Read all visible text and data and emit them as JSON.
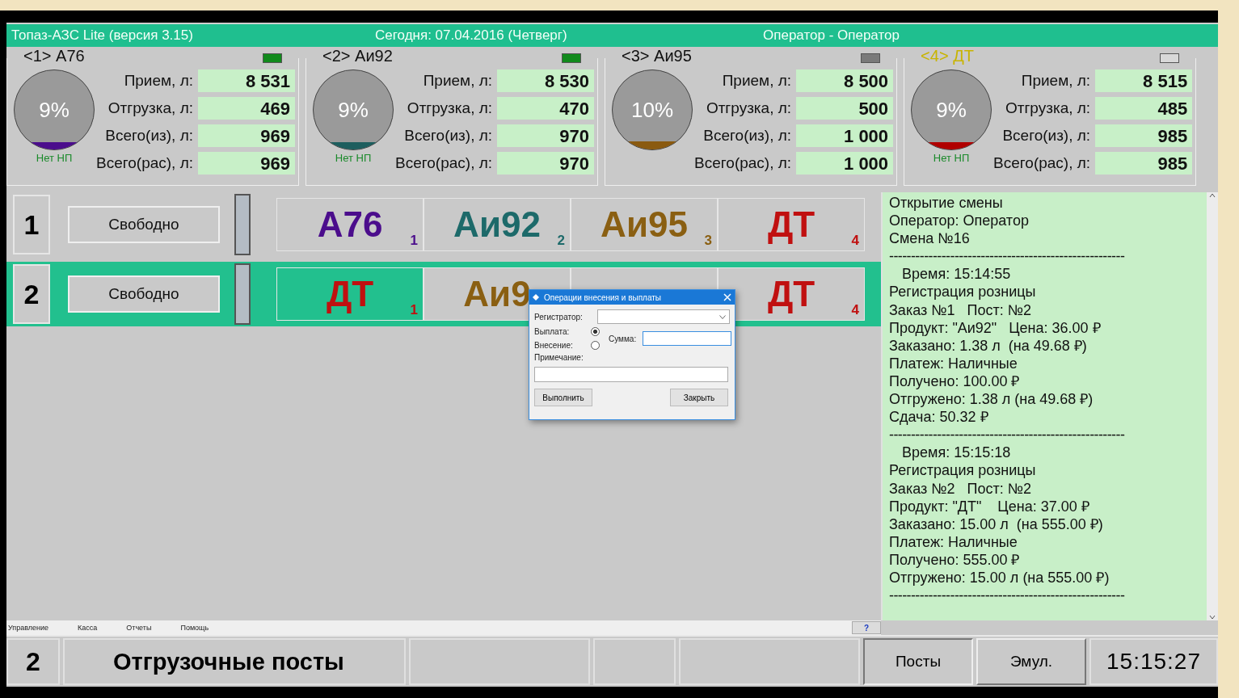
{
  "title_bar": {
    "app": "Топаз-АЗС Lite  (версия 3.15)",
    "date": "Сегодня: 07.04.2016  (Четверг)",
    "operator": "Оператор - Оператор"
  },
  "tanks": [
    {
      "title": "<1> А76",
      "selected": false,
      "indicator": {
        "color": "#118a1c"
      },
      "color": "#4b0d8c",
      "percent": "9%",
      "status": "Нет НП",
      "rows": [
        {
          "label": "Прием, л:",
          "value": "8 531"
        },
        {
          "label": "Отгрузка, л:",
          "value": "469"
        },
        {
          "label": "Всего(из), л:",
          "value": "969"
        },
        {
          "label": "Всего(рас), л:",
          "value": "969"
        }
      ]
    },
    {
      "title": "<2> Аи92",
      "selected": false,
      "indicator": {
        "color": "#118a1c"
      },
      "color": "#1d5e5e",
      "percent": "9%",
      "status": "Нет НП",
      "rows": [
        {
          "label": "Прием, л:",
          "value": "8 530"
        },
        {
          "label": "Отгрузка, л:",
          "value": "470"
        },
        {
          "label": "Всего(из), л:",
          "value": "970"
        },
        {
          "label": "Всего(рас), л:",
          "value": "970"
        }
      ]
    },
    {
      "title": "<3> Аи95",
      "selected": false,
      "indicator": {
        "color": "#7a7a7a"
      },
      "color": "#8a5a10",
      "percent": "10%",
      "rows": [
        {
          "label": "Прием, л:",
          "value": "8 500"
        },
        {
          "label": "Отгрузка, л:",
          "value": "500"
        },
        {
          "label": "Всего(из), л:",
          "value": "1 000"
        },
        {
          "label": "Всего(рас), л:",
          "value": "1 000"
        }
      ]
    },
    {
      "title": "<4> ДТ",
      "selected": true,
      "indicator": {
        "color": "#d8d8d8"
      },
      "color": "#b00000",
      "percent": "9%",
      "status": "Нет НП",
      "rows": [
        {
          "label": "Прием, л:",
          "value": "8 515"
        },
        {
          "label": "Отгрузка, л:",
          "value": "485"
        },
        {
          "label": "Всего(из), л:",
          "value": "985"
        },
        {
          "label": "Всего(рас), л:",
          "value": "985"
        }
      ]
    }
  ],
  "posts": [
    {
      "number": "1",
      "status": "Свободно",
      "selected": false,
      "nozzles": [
        {
          "label": "А76",
          "index": "1",
          "color": "#4b0d8c",
          "selected": false
        },
        {
          "label": "Аи92",
          "index": "2",
          "color": "#1d6a6a",
          "selected": false
        },
        {
          "label": "Аи95",
          "index": "3",
          "color": "#8a5f12",
          "selected": false
        },
        {
          "label": "ДТ",
          "index": "4",
          "color": "#c01010",
          "selected": false
        }
      ]
    },
    {
      "number": "2",
      "status": "Свободно",
      "selected": true,
      "nozzles": [
        {
          "label": "ДТ",
          "index": "1",
          "color": "#c01010",
          "selected": true
        },
        {
          "label": "Аи9",
          "color": "#8a5f12",
          "selected": false
        },
        {
          "selected": false
        },
        {
          "label": "ДТ",
          "index": "4",
          "color": "#c01010",
          "selected": false
        }
      ]
    }
  ],
  "dialog": {
    "title": "Операции внесения и выплаты",
    "registrar_label": "Регистратор:",
    "options": [
      {
        "label": "Выплата:",
        "selected": true
      },
      {
        "label": "Внесение:",
        "selected": false
      }
    ],
    "sum_label": "Сумма:",
    "note_label": "Примечание:",
    "buttons": [
      "Выполнить",
      "Закрыть"
    ]
  },
  "log": [
    {
      "kind": "text",
      "text": "Открытие смены"
    },
    {
      "kind": "text",
      "text": "Оператор: Оператор"
    },
    {
      "kind": "text",
      "text": "Смена №16"
    },
    {
      "kind": "rule",
      "text": "------------------------------------------------------"
    },
    {
      "kind": "indent",
      "text": "Время: 15:14:55"
    },
    {
      "kind": "text",
      "text": "Регистрация розницы"
    },
    {
      "kind": "text",
      "text": "Заказ №1   Пост: №2"
    },
    {
      "kind": "text",
      "text": "Продукт: \"Аи92\"   Цена: 36.00 ₽"
    },
    {
      "kind": "text",
      "text": "Заказано: 1.38 л  (на 49.68 ₽)"
    },
    {
      "kind": "text",
      "text": "Платеж: Наличные"
    },
    {
      "kind": "text",
      "text": "Получено: 100.00 ₽"
    },
    {
      "kind": "text",
      "text": "Отгружено: 1.38 л (на 49.68 ₽)"
    },
    {
      "kind": "text",
      "text": "Сдача: 50.32 ₽"
    },
    {
      "kind": "rule",
      "text": "------------------------------------------------------"
    },
    {
      "kind": "indent",
      "text": "Время: 15:15:18"
    },
    {
      "kind": "text",
      "text": "Регистрация розницы"
    },
    {
      "kind": "text",
      "text": "Заказ №2   Пост: №2"
    },
    {
      "kind": "text",
      "text": "Продукт: \"ДТ\"    Цена: 37.00 ₽"
    },
    {
      "kind": "text",
      "text": "Заказано: 15.00 л  (на 555.00 ₽)"
    },
    {
      "kind": "text",
      "text": "Платеж: Наличные"
    },
    {
      "kind": "text",
      "text": "Получено: 555.00 ₽"
    },
    {
      "kind": "text",
      "text": "Отгружено: 15.00 л (на 555.00 ₽)"
    },
    {
      "kind": "rule",
      "text": "------------------------------------------------------"
    }
  ],
  "menu": [
    "Управление",
    "Касса",
    "Отчеты",
    "Помощь"
  ],
  "help_button": "?",
  "status_bar": {
    "post_number": "2",
    "title": "Отгрузочные посты",
    "buttons": [
      {
        "label": "Посты",
        "selected": true
      },
      {
        "label": "Эмул.",
        "selected": false
      }
    ],
    "time": "15:15:27"
  }
}
